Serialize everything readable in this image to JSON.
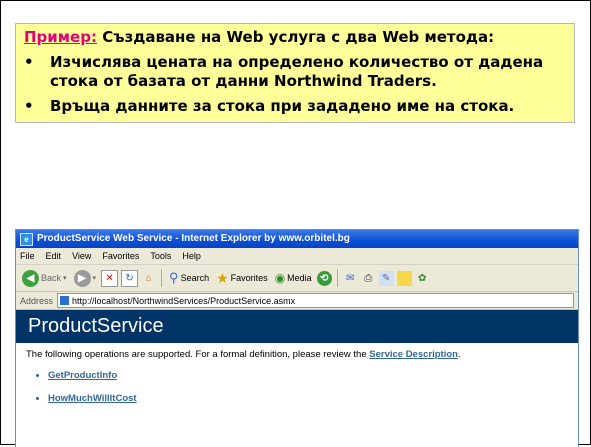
{
  "caption": {
    "lead": "Пример:",
    "title_text": " Създаване на Web услуга с два Web метода:",
    "bullet_glyph": "•",
    "bullets": [
      "Изчислява цената на определено количество от дадена стока от базата от данни Northwind Traders.",
      "Връща данните за стока при зададено име на стока."
    ]
  },
  "browser": {
    "title": "ProductService Web Service - Internet Explorer by www.orbitel.bg",
    "menu": [
      "File",
      "Edit",
      "View",
      "Favorites",
      "Tools",
      "Help"
    ],
    "toolbar": {
      "back": "Back",
      "search": "Search",
      "favorites": "Favorites",
      "media": "Media"
    },
    "address_label": "Address",
    "address_url": "http://localhost/NorthwindServices/ProductService.asmx",
    "page": {
      "heading": "ProductService",
      "ops_text": "The following operations are supported. For a formal definition, please review the ",
      "service_description": "Service Description",
      "ops_end": ".",
      "operations": [
        "GetProductInfo",
        "HowMuchWillItCost"
      ]
    }
  },
  "colors": {
    "caption_bg": "#ffff99",
    "lead": "#e2007a",
    "banner_bg": "#003366",
    "link": "#336699"
  }
}
